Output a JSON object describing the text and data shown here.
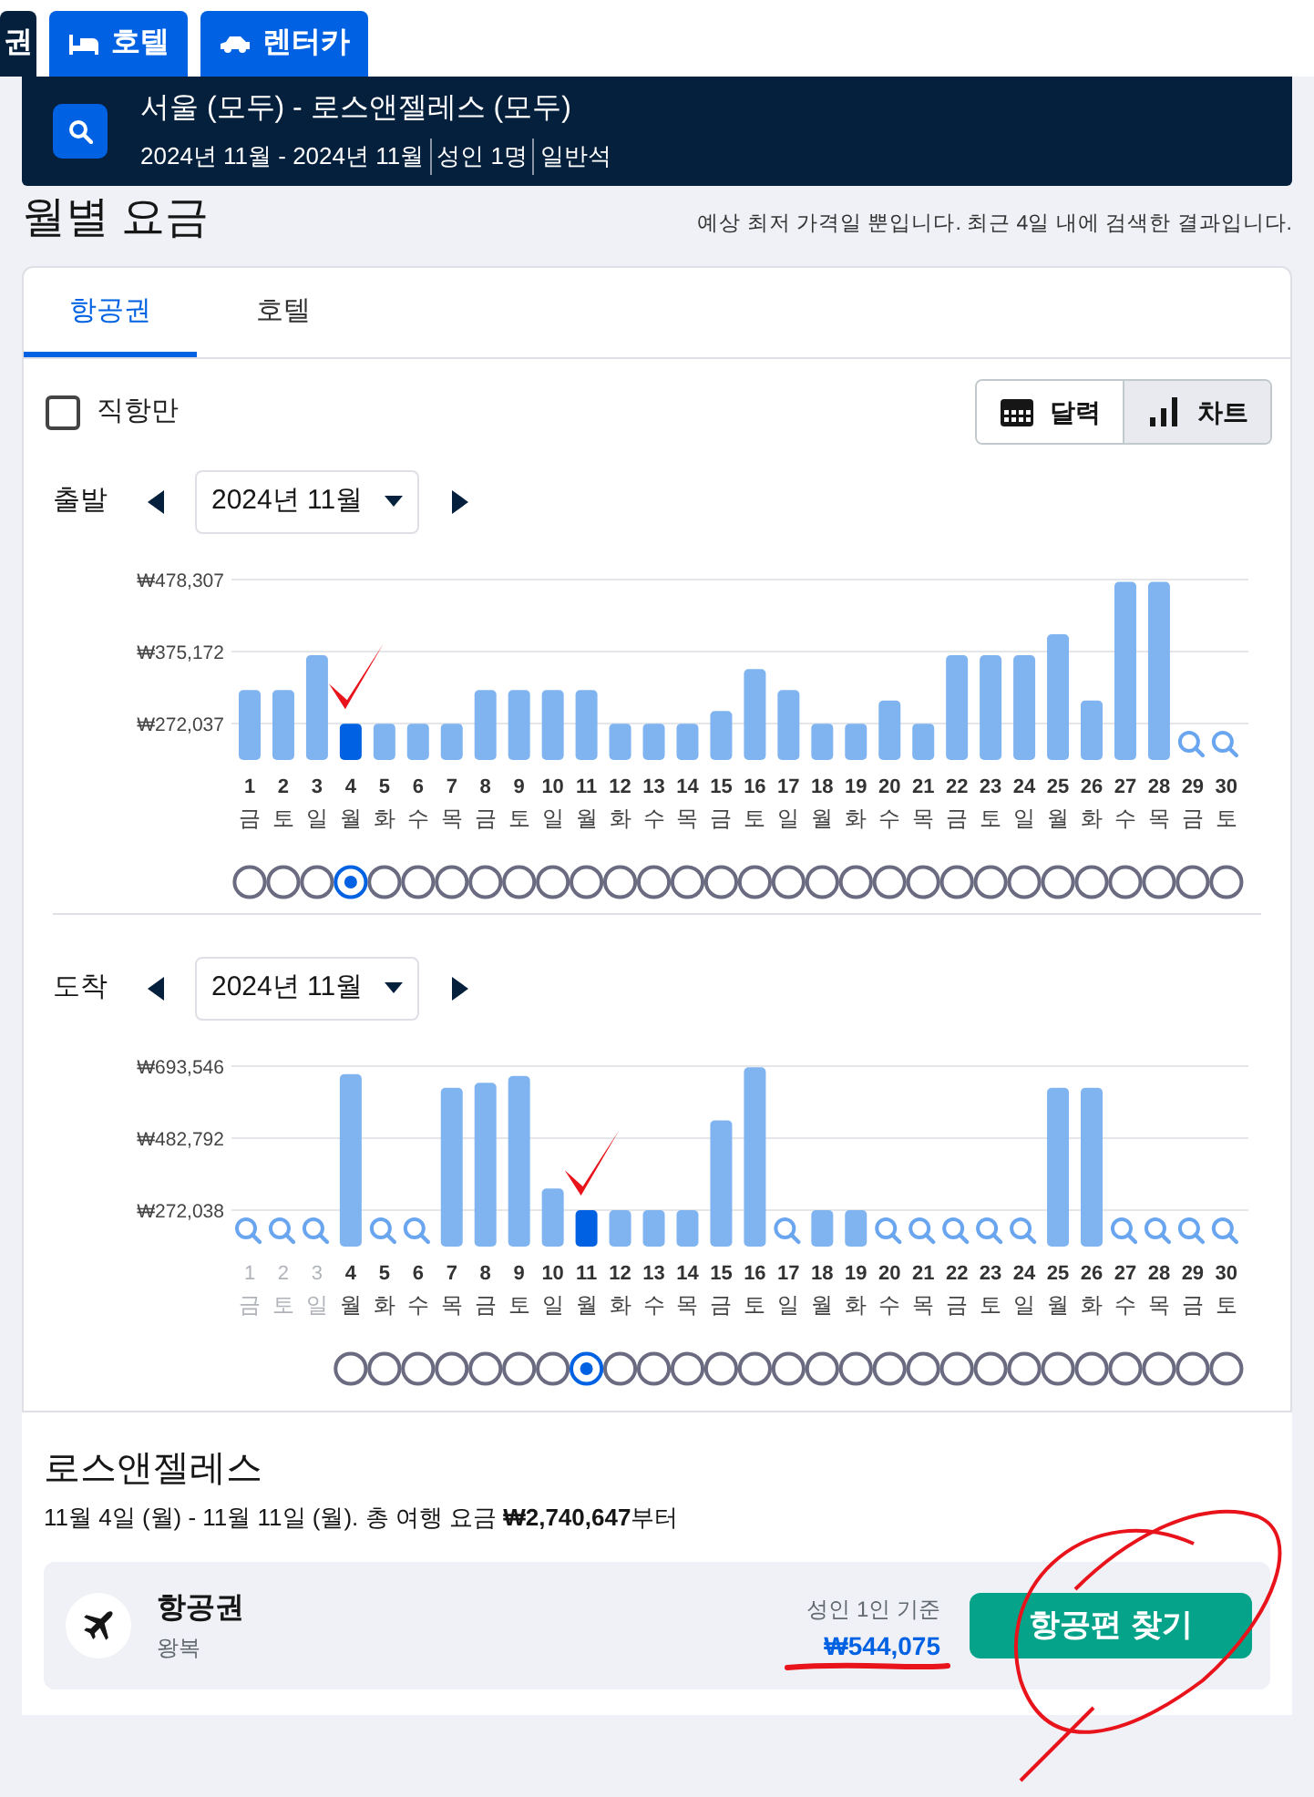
{
  "top_tabs": [
    {
      "label": "권",
      "kind": "cut",
      "selected": true
    },
    {
      "label": "호텔",
      "kind": "hotel",
      "selected": false
    },
    {
      "label": "렌터카",
      "kind": "car",
      "selected": false
    }
  ],
  "search_summary": {
    "route": "서울 (모두) - 로스앤젤레스 (모두)",
    "details": [
      "2024년 11월 - 2024년 11월",
      "성인 1명",
      "일반석"
    ]
  },
  "title": "월별 요금",
  "note": "예상 최저 가격일 뿐입니다. 최근 4일 내에 검색한 결과입니다.",
  "card_tabs": [
    {
      "label": "항공권",
      "selected": true
    },
    {
      "label": "호텔",
      "selected": false
    }
  ],
  "direct_only": {
    "label": "직항만",
    "checked": false
  },
  "view_toggle": [
    {
      "label": "달력",
      "kind": "calendar",
      "selected": false
    },
    {
      "label": "차트",
      "kind": "chart",
      "selected": true
    }
  ],
  "sections": [
    {
      "label": "출발",
      "month": "2024년 11월",
      "chart_data": {
        "type": "bar",
        "categories": [
          "1",
          "2",
          "3",
          "4",
          "5",
          "6",
          "7",
          "8",
          "9",
          "10",
          "11",
          "12",
          "13",
          "14",
          "15",
          "16",
          "17",
          "18",
          "19",
          "20",
          "21",
          "22",
          "23",
          "24",
          "25",
          "26",
          "27",
          "28",
          "29",
          "30"
        ],
        "values": [
          320000,
          320000,
          370000,
          272000,
          272000,
          272000,
          272000,
          320000,
          320000,
          320000,
          320000,
          272000,
          272000,
          272000,
          290000,
          350000,
          320000,
          272000,
          272000,
          305000,
          272000,
          370000,
          370000,
          370000,
          400000,
          305000,
          475000,
          475000,
          null,
          null
        ],
        "ylim": [
          220000,
          478307
        ],
        "yticks": [
          {
            "value": 272037,
            "label": "₩272,037"
          },
          {
            "value": 375172,
            "label": "₩375,172"
          },
          {
            "value": 478307,
            "label": "₩478,307"
          }
        ]
      },
      "weekdays": [
        {
          "label": "금",
          "disabled": false
        },
        {
          "label": "토",
          "disabled": false
        },
        {
          "label": "일",
          "disabled": false
        },
        {
          "label": "월",
          "disabled": false
        },
        {
          "label": "화",
          "disabled": false
        },
        {
          "label": "수",
          "disabled": false
        },
        {
          "label": "목",
          "disabled": false
        },
        {
          "label": "금",
          "disabled": false
        },
        {
          "label": "토",
          "disabled": false
        },
        {
          "label": "일",
          "disabled": false
        },
        {
          "label": "월",
          "disabled": false
        },
        {
          "label": "화",
          "disabled": false
        },
        {
          "label": "수",
          "disabled": false
        },
        {
          "label": "목",
          "disabled": false
        },
        {
          "label": "금",
          "disabled": false
        },
        {
          "label": "토",
          "disabled": false
        },
        {
          "label": "일",
          "disabled": false
        },
        {
          "label": "월",
          "disabled": false
        },
        {
          "label": "화",
          "disabled": false
        },
        {
          "label": "수",
          "disabled": false
        },
        {
          "label": "목",
          "disabled": false
        },
        {
          "label": "금",
          "disabled": false
        },
        {
          "label": "토",
          "disabled": false
        },
        {
          "label": "일",
          "disabled": false
        },
        {
          "label": "월",
          "disabled": false
        },
        {
          "label": "화",
          "disabled": false
        },
        {
          "label": "수",
          "disabled": false
        },
        {
          "label": "목",
          "disabled": false
        },
        {
          "label": "금",
          "disabled": false
        },
        {
          "label": "토",
          "disabled": false
        }
      ],
      "radios": [
        {
          "selected": false
        },
        {
          "selected": false
        },
        {
          "selected": false
        },
        {
          "selected": true
        },
        {
          "selected": false
        },
        {
          "selected": false
        },
        {
          "selected": false
        },
        {
          "selected": false
        },
        {
          "selected": false
        },
        {
          "selected": false
        },
        {
          "selected": false
        },
        {
          "selected": false
        },
        {
          "selected": false
        },
        {
          "selected": false
        },
        {
          "selected": false
        },
        {
          "selected": false
        },
        {
          "selected": false
        },
        {
          "selected": false
        },
        {
          "selected": false
        },
        {
          "selected": false
        },
        {
          "selected": false
        },
        {
          "selected": false
        },
        {
          "selected": false
        },
        {
          "selected": false
        },
        {
          "selected": false
        },
        {
          "selected": false
        },
        {
          "selected": false
        },
        {
          "selected": false
        },
        {
          "selected": false
        },
        {
          "selected": false
        }
      ]
    },
    {
      "label": "도착",
      "month": "2024년 11월",
      "chart_data": {
        "type": "bar",
        "categories": [
          "1",
          "2",
          "3",
          "4",
          "5",
          "6",
          "7",
          "8",
          "9",
          "10",
          "11",
          "12",
          "13",
          "14",
          "15",
          "16",
          "17",
          "18",
          "19",
          "20",
          "21",
          "22",
          "23",
          "24",
          "25",
          "26",
          "27",
          "28",
          "29",
          "30"
        ],
        "values": [
          null,
          null,
          null,
          670000,
          null,
          null,
          630000,
          645000,
          665000,
          335000,
          272000,
          272000,
          272000,
          272000,
          535000,
          690000,
          null,
          272000,
          272000,
          null,
          null,
          null,
          null,
          null,
          630000,
          630000,
          null,
          null,
          null,
          null
        ],
        "ylim": [
          165000,
          693546
        ],
        "yticks": [
          {
            "value": 272038,
            "label": "₩272,038"
          },
          {
            "value": 482792,
            "label": "₩482,792"
          },
          {
            "value": 693546,
            "label": "₩693,546"
          }
        ]
      },
      "weekdays": [
        {
          "label": "금",
          "disabled": true
        },
        {
          "label": "토",
          "disabled": true
        },
        {
          "label": "일",
          "disabled": true
        },
        {
          "label": "월",
          "disabled": false
        },
        {
          "label": "화",
          "disabled": false
        },
        {
          "label": "수",
          "disabled": false
        },
        {
          "label": "목",
          "disabled": false
        },
        {
          "label": "금",
          "disabled": false
        },
        {
          "label": "토",
          "disabled": false
        },
        {
          "label": "일",
          "disabled": false
        },
        {
          "label": "월",
          "disabled": false
        },
        {
          "label": "화",
          "disabled": false
        },
        {
          "label": "수",
          "disabled": false
        },
        {
          "label": "목",
          "disabled": false
        },
        {
          "label": "금",
          "disabled": false
        },
        {
          "label": "토",
          "disabled": false
        },
        {
          "label": "일",
          "disabled": false
        },
        {
          "label": "월",
          "disabled": false
        },
        {
          "label": "화",
          "disabled": false
        },
        {
          "label": "수",
          "disabled": false
        },
        {
          "label": "목",
          "disabled": false
        },
        {
          "label": "금",
          "disabled": false
        },
        {
          "label": "토",
          "disabled": false
        },
        {
          "label": "일",
          "disabled": false
        },
        {
          "label": "월",
          "disabled": false
        },
        {
          "label": "화",
          "disabled": false
        },
        {
          "label": "수",
          "disabled": false
        },
        {
          "label": "목",
          "disabled": false
        },
        {
          "label": "금",
          "disabled": false
        },
        {
          "label": "토",
          "disabled": false
        }
      ],
      "radios": [
        {
          "selected": false
        },
        {
          "selected": false
        },
        {
          "selected": false
        },
        {
          "selected": false
        },
        {
          "selected": false
        },
        {
          "selected": false
        },
        {
          "selected": false
        },
        {
          "selected": true
        },
        {
          "selected": false
        },
        {
          "selected": false
        },
        {
          "selected": false
        },
        {
          "selected": false
        },
        {
          "selected": false
        },
        {
          "selected": false
        },
        {
          "selected": false
        },
        {
          "selected": false
        },
        {
          "selected": false
        },
        {
          "selected": false
        },
        {
          "selected": false
        },
        {
          "selected": false
        },
        {
          "selected": false
        },
        {
          "selected": false
        },
        {
          "selected": false
        },
        {
          "selected": false
        },
        {
          "selected": false
        },
        {
          "selected": false
        },
        {
          "selected": false
        }
      ]
    }
  ],
  "result": {
    "city": "로스앤젤레스",
    "summary": "11월 4일 (월) - 11월 11일 (월). 총 여행 요금 **₩2,740,647**부터",
    "offer": {
      "name": "항공권",
      "trip": "왕복",
      "price_label": "성인 1인 기준",
      "price": "₩544,075",
      "button": "항공편 찾기"
    }
  }
}
